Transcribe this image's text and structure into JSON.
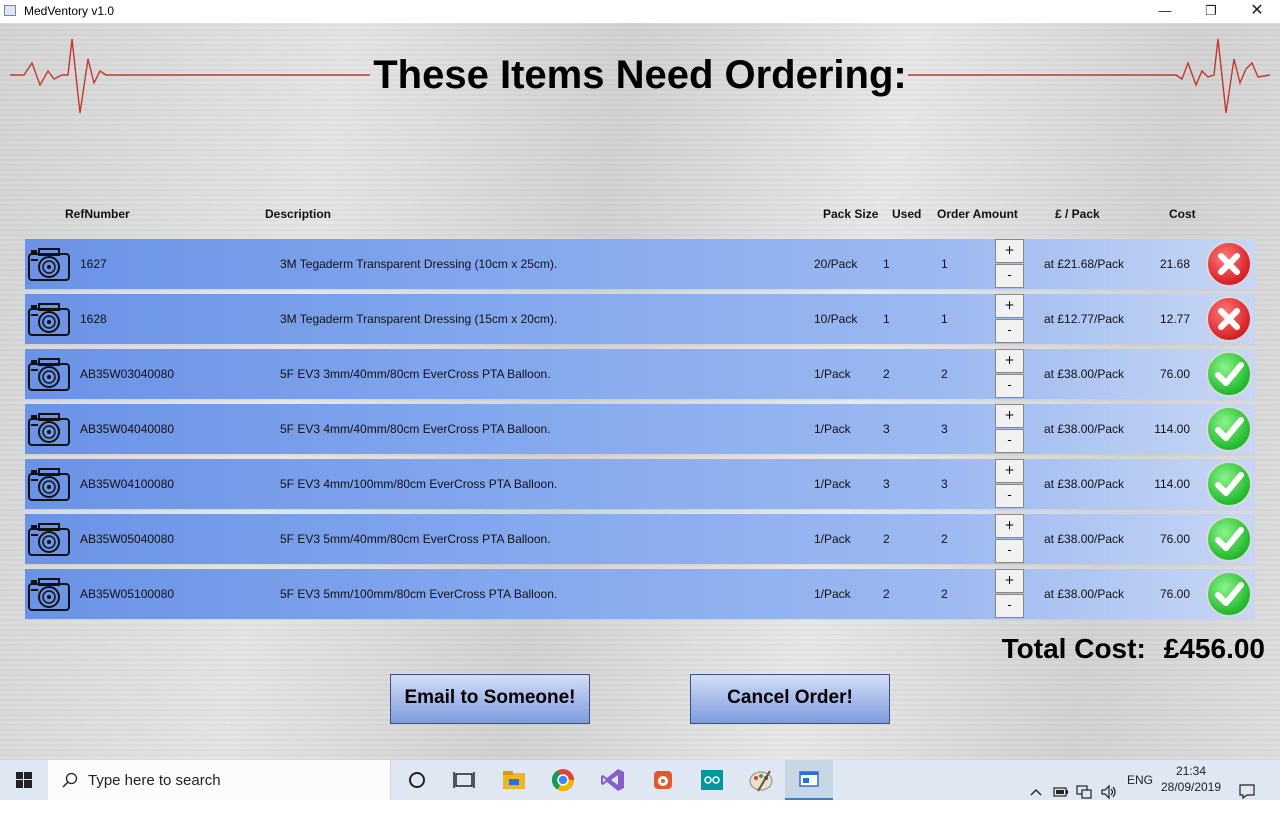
{
  "window": {
    "title": "MedVentory v1.0"
  },
  "heading": "These Items Need Ordering:",
  "columns": {
    "ref": "RefNumber",
    "desc": "Description",
    "pack": "Pack Size",
    "used": "Used",
    "order": "Order Amount",
    "price": "£ / Pack",
    "cost": "Cost"
  },
  "rows": [
    {
      "ref": "1627",
      "desc": "3M Tegaderm Transparent Dressing (10cm x 25cm).",
      "pack": "20/Pack",
      "used": "1",
      "order": "1",
      "price": "at £21.68/Pack",
      "cost": "21.68",
      "status": "reject"
    },
    {
      "ref": "1628",
      "desc": "3M Tegaderm Transparent Dressing (15cm x 20cm).",
      "pack": "10/Pack",
      "used": "1",
      "order": "1",
      "price": "at £12.77/Pack",
      "cost": "12.77",
      "status": "reject"
    },
    {
      "ref": "AB35W03040080",
      "desc": "5F EV3 3mm/40mm/80cm EverCross PTA Balloon.",
      "pack": "1/Pack",
      "used": "2",
      "order": "2",
      "price": "at £38.00/Pack",
      "cost": "76.00",
      "status": "approve"
    },
    {
      "ref": "AB35W04040080",
      "desc": "5F EV3 4mm/40mm/80cm EverCross PTA Balloon.",
      "pack": "1/Pack",
      "used": "3",
      "order": "3",
      "price": "at £38.00/Pack",
      "cost": "114.00",
      "status": "approve"
    },
    {
      "ref": "AB35W04100080",
      "desc": "5F EV3 4mm/100mm/80cm EverCross PTA Balloon.",
      "pack": "1/Pack",
      "used": "3",
      "order": "3",
      "price": "at £38.00/Pack",
      "cost": "114.00",
      "status": "approve"
    },
    {
      "ref": "AB35W05040080",
      "desc": "5F EV3 5mm/40mm/80cm EverCross PTA Balloon.",
      "pack": "1/Pack",
      "used": "2",
      "order": "2",
      "price": "at £38.00/Pack",
      "cost": "76.00",
      "status": "approve"
    },
    {
      "ref": "AB35W05100080",
      "desc": "5F EV3 5mm/100mm/80cm EverCross PTA Balloon.",
      "pack": "1/Pack",
      "used": "2",
      "order": "2",
      "price": "at £38.00/Pack",
      "cost": "76.00",
      "status": "approve"
    }
  ],
  "stepper": {
    "plus": "+",
    "minus": "-"
  },
  "total": {
    "label": "Total Cost:",
    "value": "£456.00"
  },
  "buttons": {
    "email": "Email to Someone!",
    "cancel": "Cancel Order!"
  },
  "taskbar": {
    "search_placeholder": "Type here to search",
    "language": "ENG",
    "time": "21:34",
    "date": "28/09/2019"
  },
  "colors": {
    "row_start": "#6a92e6",
    "row_end": "#c7d6f4",
    "ecg_line": "#c0392b",
    "approve": "#2ecc40",
    "reject": "#e0262b"
  }
}
